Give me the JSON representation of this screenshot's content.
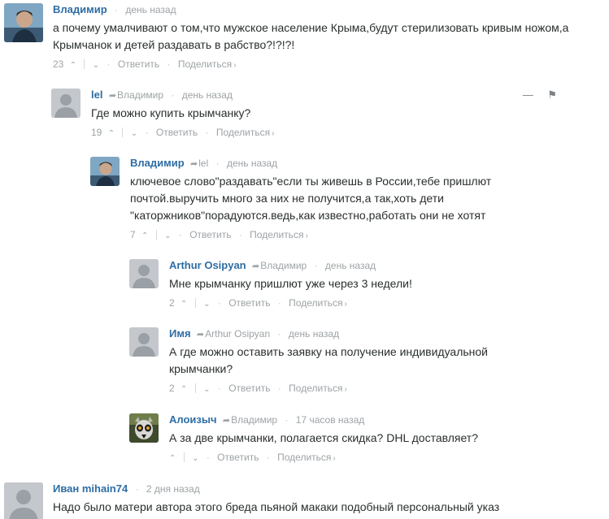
{
  "comments": [
    {
      "author": "Владимир",
      "reply_to": "",
      "time": "день назад",
      "text": "а почему умалчивают о том,что мужское население Крыма,будут стерилизовать кривым ножом,а Крымчанок и детей раздавать в рабство?!?!?!",
      "votes": "23",
      "reply": "Ответить",
      "share": "Поделиться"
    },
    {
      "author": "lel",
      "reply_to": "Владимир",
      "time": "день назад",
      "text": "Где можно купить крымчанку?",
      "votes": "19",
      "reply": "Ответить",
      "share": "Поделиться",
      "collapse_icon": "—",
      "flag_icon": "⚑"
    },
    {
      "author": "Владимир",
      "reply_to": "lel",
      "time": "день назад",
      "text": "ключевое слово\"раздавать\"если ты живешь в России,тебе пришлют почтой.выручить много за них не получится,а так,хоть дети \"каторжников\"порадуются.ведь,как известно,работать они не хотят",
      "votes": "7",
      "reply": "Ответить",
      "share": "Поделиться"
    },
    {
      "author": "Arthur Osipyan",
      "reply_to": "Владимир",
      "time": "день назад",
      "text": "Мне крымчанку пришлют уже через 3 недели!",
      "votes": "2",
      "reply": "Ответить",
      "share": "Поделиться"
    },
    {
      "author": "Имя",
      "reply_to": "Arthur Osipyan",
      "time": "день назад",
      "text": "А где можно оставить заявку на получение индивидуальной крымчанки?",
      "votes": "2",
      "reply": "Ответить",
      "share": "Поделиться"
    },
    {
      "author": "Алоизыч",
      "reply_to": "Владимир",
      "time": "17 часов назад",
      "text": "А за две крымчанки, полагается скидка? DHL доставляет?",
      "votes": "",
      "reply": "Ответить",
      "share": "Поделиться"
    },
    {
      "author": "Иван mihain74",
      "reply_to": "",
      "time": "2 дня назад",
      "text": "Надо было матери автора этого бреда пьяной макаки подобный персональный указ",
      "votes": "",
      "reply": "",
      "share": ""
    }
  ],
  "glyphs": {
    "up": "⌃",
    "down": "⌄",
    "dot": "·",
    "reply_arrow": "➦",
    "chevron": "›"
  },
  "colors": {
    "author": "#2e6da4",
    "meta": "#9ea3a6",
    "text": "#2a2e2e"
  }
}
